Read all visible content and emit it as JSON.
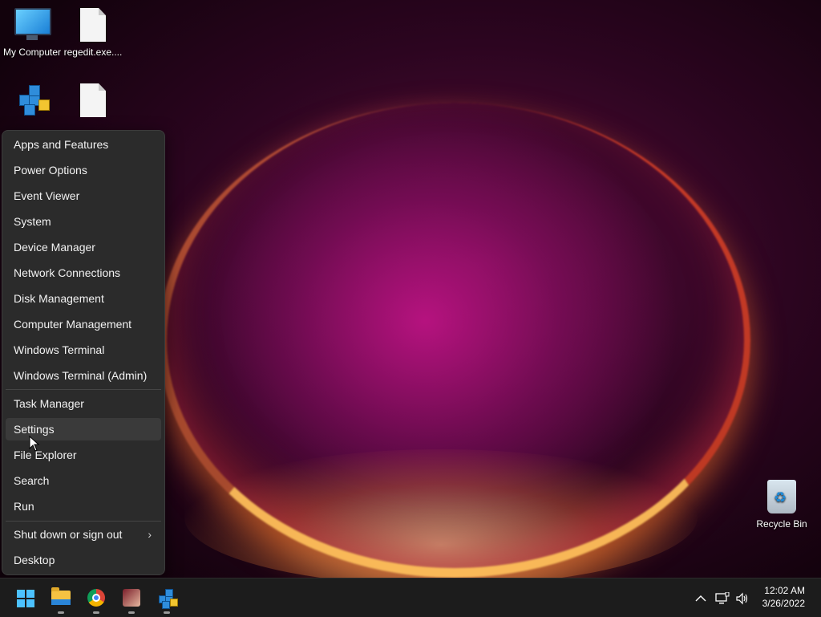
{
  "desktop": {
    "icons": [
      {
        "label": "My Computer"
      },
      {
        "label": "regedit.exe...."
      },
      {
        "label": "Recycle Bin"
      }
    ]
  },
  "menu": {
    "items": [
      {
        "label": "Apps and Features"
      },
      {
        "label": "Power Options"
      },
      {
        "label": "Event Viewer"
      },
      {
        "label": "System"
      },
      {
        "label": "Device Manager"
      },
      {
        "label": "Network Connections"
      },
      {
        "label": "Disk Management"
      },
      {
        "label": "Computer Management"
      },
      {
        "label": "Windows Terminal"
      },
      {
        "label": "Windows Terminal (Admin)"
      },
      {
        "label": "Task Manager"
      },
      {
        "label": "Settings"
      },
      {
        "label": "File Explorer"
      },
      {
        "label": "Search"
      },
      {
        "label": "Run"
      },
      {
        "label": "Shut down or sign out"
      },
      {
        "label": "Desktop"
      }
    ],
    "highlighted": "Settings",
    "submenu_glyph": "›"
  },
  "taskbar": {
    "apps": [
      "start-icon",
      "file-explorer-icon",
      "chrome-icon",
      "app-avatar-icon",
      "regedit-icon"
    ],
    "tray": {
      "chevron_glyph": "^",
      "clock_time": "12:02 AM",
      "clock_date": "3/26/2022"
    }
  },
  "colors": {
    "menu_bg": "#2b2b2b",
    "taskbar_bg": "#1c1c1c",
    "accent": "#4cc2ff"
  }
}
